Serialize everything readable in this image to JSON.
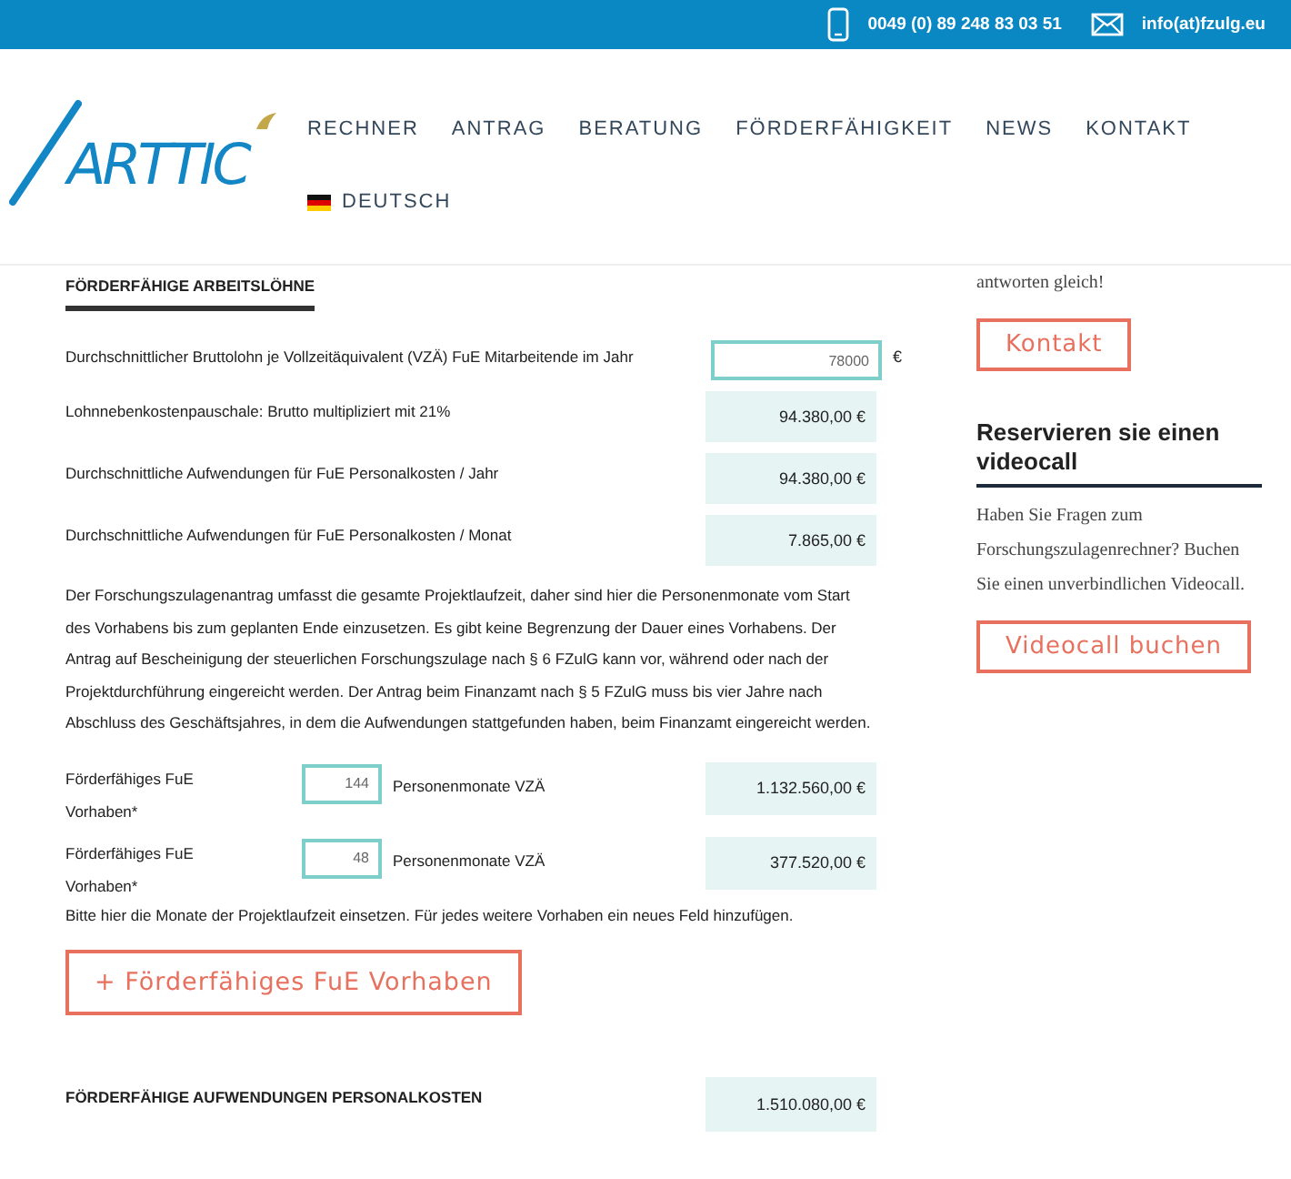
{
  "top_bar": {
    "phone": "0049 (0) 89 248 83 03 51",
    "email": "info(at)fzulg.eu"
  },
  "header": {
    "logo": "ARTTIC",
    "nav": [
      "RECHNER",
      "ANTRAG",
      "BERATUNG",
      "FÖRDERFÄHIGKEIT",
      "NEWS",
      "KONTAKT"
    ],
    "language": "DEUTSCH"
  },
  "calculator": {
    "section_title": "FÖRDERFÄHIGE ARBEITSLÖHNE",
    "rows": [
      {
        "kind": "input",
        "label": "Durchschnittlicher Bruttolohn je Vollzeitäquivalent (VZÄ) FuE Mitarbeitende im Jahr",
        "value": "78000",
        "unit": "€"
      },
      {
        "kind": "output",
        "label": "Lohnnebenkostenpauschale: Brutto multipliziert mit 21%",
        "value": "94.380,00 €"
      },
      {
        "kind": "output",
        "label": "Durchschnittliche Aufwendungen für FuE Personalkosten / Jahr",
        "value": "94.380,00 €"
      },
      {
        "kind": "output",
        "label": "Durchschnittliche Aufwendungen für FuE Personalkosten / Monat",
        "value": "7.865,00 €"
      }
    ],
    "intro": "Der Forschungszulagenantrag umfasst die gesamte Projektlaufzeit, daher sind hier die Personenmonate vom Start des Vorhabens bis zum geplanten Ende einzusetzen. Es gibt keine Begrenzung der Dauer eines Vorhabens. Der Antrag auf Bescheinigung der steuerlichen Forschungszulage nach § 6 FZulG kann vor, während oder nach der Projektdurchführung eingereicht werden. Der Antrag beim Finanzamt nach § 5 FZulG muss bis vier Jahre nach Abschluss des Geschäftsjahres, in dem die Aufwendungen stattgefunden haben, beim Finanzamt eingereicht werden.",
    "projects": [
      {
        "label": "Förderfähiges FuE Vorhaben*",
        "value": "144",
        "unit": "Personenmonate VZÄ",
        "amount": "1.132.560,00 €"
      },
      {
        "label": "Förderfähiges FuE Vorhaben*",
        "value": "48",
        "unit": "Personenmonate VZÄ",
        "amount": "377.520,00 €"
      }
    ],
    "hint": "Bitte hier die Monate der Projektlaufzeit einsetzen. Für jedes weitere Vorhaben ein neues Feld hinzufügen.",
    "add_button": "+ Förderfähiges FuE Vorhaben",
    "total": {
      "label": "FÖRDERFÄHIGE AUFWENDUNGEN PERSONALKOSTEN",
      "value": "1.510.080,00 €"
    }
  },
  "sidebar": {
    "text_end": "antworten gleich!",
    "contact_button": "Kontakt",
    "heading": "Reservieren sie einen videocall",
    "text": "Haben Sie Fragen zum Forschungszulagenrechner? Buchen Sie einen unverbindlichen Videocall.",
    "video_button": "Videocall buchen"
  }
}
